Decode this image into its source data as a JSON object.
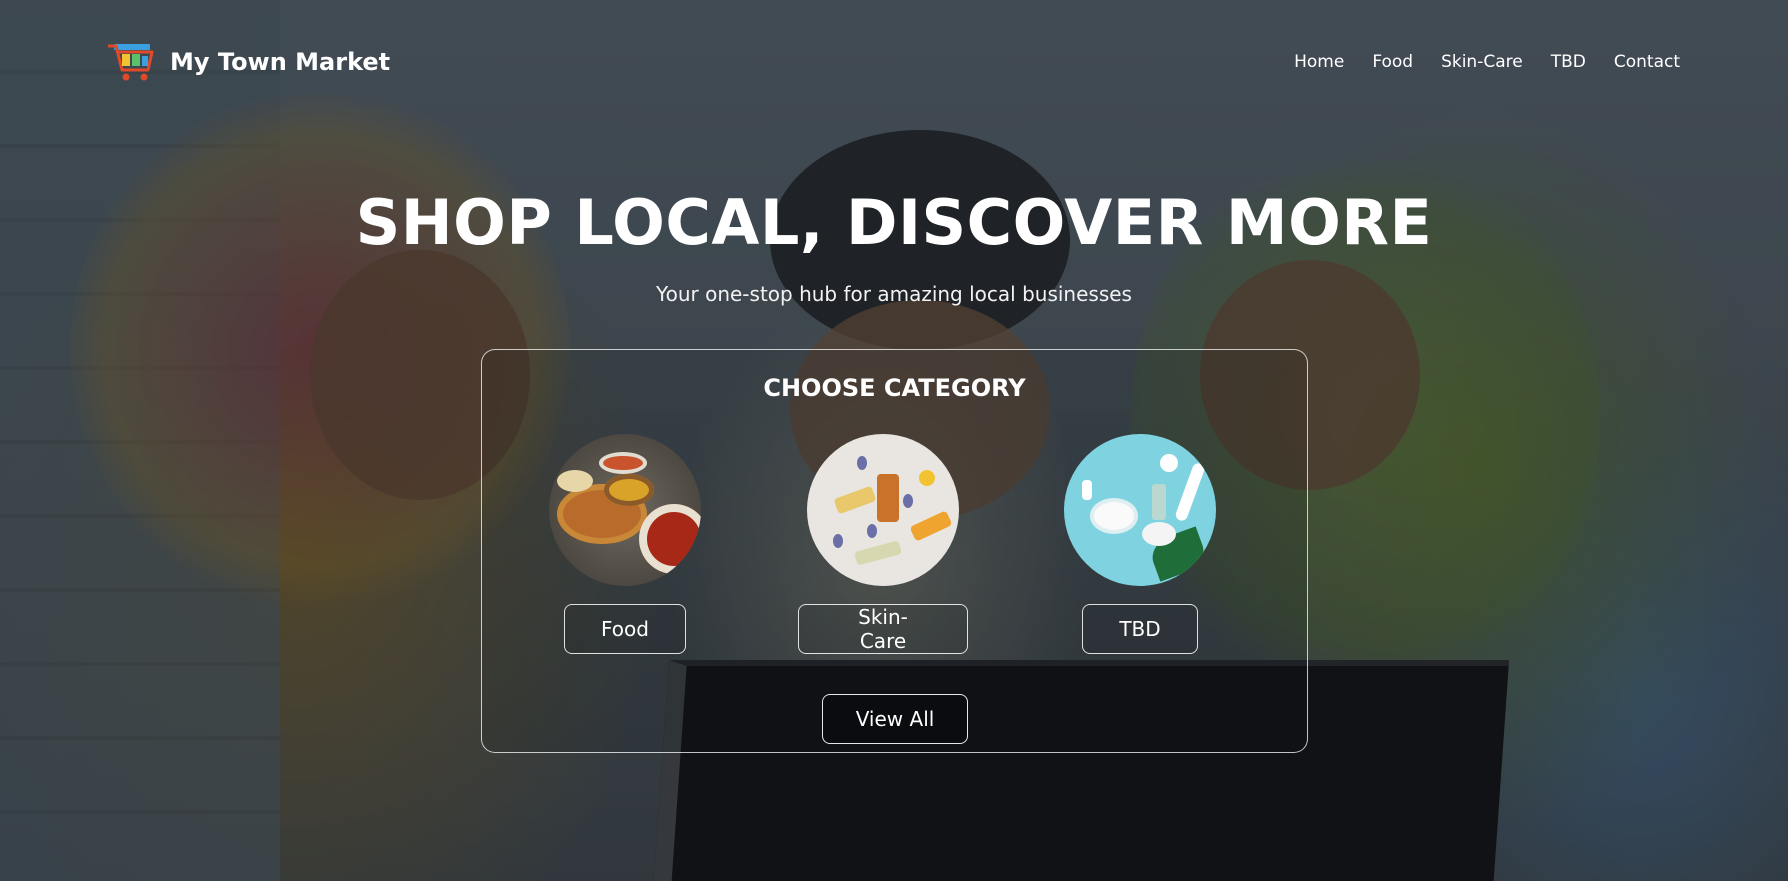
{
  "brand": {
    "name": "My Town Market",
    "logo_icon": "shopping-cart-icon"
  },
  "nav": {
    "items": [
      "Home",
      "Food",
      "Skin-Care",
      "TBD",
      "Contact"
    ]
  },
  "hero": {
    "title": "SHOP LOCAL, DISCOVER MORE",
    "subtitle": "Your one-stop hub for amazing local businesses"
  },
  "categories": {
    "title": "CHOOSE CATEGORY",
    "items": [
      {
        "label": "Food",
        "image": "food-image"
      },
      {
        "label": "Skin-Care",
        "image": "skincare-image"
      },
      {
        "label": "TBD",
        "image": "tbd-image"
      }
    ],
    "view_all_label": "View All"
  },
  "colors": {
    "overlay": "#141a20",
    "text": "#ffffff",
    "logo_accent": "#e04a2a"
  }
}
